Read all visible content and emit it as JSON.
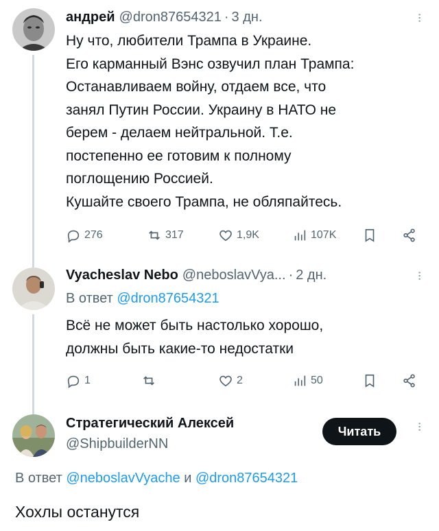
{
  "tweets": [
    {
      "author": "андрей",
      "handle": "@dron87654321",
      "time": "3 дн.",
      "lines": [
        "Ну что, любители Трампа в Украине.",
        "Его карманный Вэнс озвучил план Трампа:",
        "Останавливаем войну, отдаем все, что",
        "занял Путин России. Украину в НАТО не",
        "берем - делаем нейтральной. Т.е.",
        "постепенно ее готовим к полному",
        "поглощению Россией.",
        "Кушайте своего Трампа, не обляпайтесь."
      ],
      "stats": {
        "replies": "276",
        "retweets": "317",
        "likes": "1,9K",
        "views": "107K"
      }
    },
    {
      "author": "Vyacheslav Nebo",
      "handle": "@neboslavVya...",
      "time": "2 дн.",
      "reply_prefix": "В ответ",
      "reply_handle": "@dron87654321",
      "lines": [
        "Всё не может быть настолько хорошо,",
        "должны быть какие-то недостатки"
      ],
      "stats": {
        "replies": "1",
        "retweets": "",
        "likes": "2",
        "views": "50"
      }
    },
    {
      "author": "Стратегический Алексей",
      "handle": "@ShipbuilderNN",
      "follow_label": "Читать",
      "reply_prefix": "В ответ",
      "reply_handle_1": "@neboslavVyache",
      "reply_conj": "и",
      "reply_handle_2": "@dron87654321",
      "text": "Хохлы останутся"
    }
  ],
  "colors": {
    "link": "#1d9bf0",
    "secondary": "#536471",
    "thread_line": "#cfd9de"
  }
}
